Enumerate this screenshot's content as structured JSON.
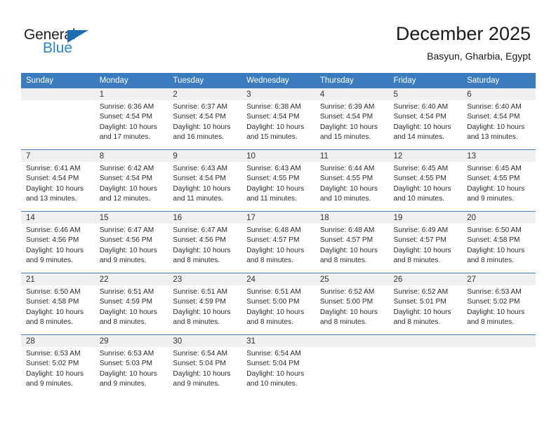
{
  "brand": {
    "name_part1": "General",
    "name_part2": "Blue",
    "triangle_color": "#1b6cb0",
    "blue_color": "#2a85d0"
  },
  "header": {
    "title": "December 2025",
    "subtitle": "Basyun, Gharbia, Egypt"
  },
  "theme": {
    "header_row_bg": "#3a7cbe",
    "daynum_band_bg": "#f0f0f0",
    "row_divider": "#4a7ebb",
    "cell_bg": "#ffffff"
  },
  "weekday_headers": [
    "Sunday",
    "Monday",
    "Tuesday",
    "Wednesday",
    "Thursday",
    "Friday",
    "Saturday"
  ],
  "weeks": [
    [
      {
        "day": "",
        "sunrise": "",
        "sunset": "",
        "daylight": ""
      },
      {
        "day": "1",
        "sunrise": "Sunrise: 6:36 AM",
        "sunset": "Sunset: 4:54 PM",
        "daylight": "Daylight: 10 hours and 17 minutes."
      },
      {
        "day": "2",
        "sunrise": "Sunrise: 6:37 AM",
        "sunset": "Sunset: 4:54 PM",
        "daylight": "Daylight: 10 hours and 16 minutes."
      },
      {
        "day": "3",
        "sunrise": "Sunrise: 6:38 AM",
        "sunset": "Sunset: 4:54 PM",
        "daylight": "Daylight: 10 hours and 15 minutes."
      },
      {
        "day": "4",
        "sunrise": "Sunrise: 6:39 AM",
        "sunset": "Sunset: 4:54 PM",
        "daylight": "Daylight: 10 hours and 15 minutes."
      },
      {
        "day": "5",
        "sunrise": "Sunrise: 6:40 AM",
        "sunset": "Sunset: 4:54 PM",
        "daylight": "Daylight: 10 hours and 14 minutes."
      },
      {
        "day": "6",
        "sunrise": "Sunrise: 6:40 AM",
        "sunset": "Sunset: 4:54 PM",
        "daylight": "Daylight: 10 hours and 13 minutes."
      }
    ],
    [
      {
        "day": "7",
        "sunrise": "Sunrise: 6:41 AM",
        "sunset": "Sunset: 4:54 PM",
        "daylight": "Daylight: 10 hours and 13 minutes."
      },
      {
        "day": "8",
        "sunrise": "Sunrise: 6:42 AM",
        "sunset": "Sunset: 4:54 PM",
        "daylight": "Daylight: 10 hours and 12 minutes."
      },
      {
        "day": "9",
        "sunrise": "Sunrise: 6:43 AM",
        "sunset": "Sunset: 4:54 PM",
        "daylight": "Daylight: 10 hours and 11 minutes."
      },
      {
        "day": "10",
        "sunrise": "Sunrise: 6:43 AM",
        "sunset": "Sunset: 4:55 PM",
        "daylight": "Daylight: 10 hours and 11 minutes."
      },
      {
        "day": "11",
        "sunrise": "Sunrise: 6:44 AM",
        "sunset": "Sunset: 4:55 PM",
        "daylight": "Daylight: 10 hours and 10 minutes."
      },
      {
        "day": "12",
        "sunrise": "Sunrise: 6:45 AM",
        "sunset": "Sunset: 4:55 PM",
        "daylight": "Daylight: 10 hours and 10 minutes."
      },
      {
        "day": "13",
        "sunrise": "Sunrise: 6:45 AM",
        "sunset": "Sunset: 4:55 PM",
        "daylight": "Daylight: 10 hours and 9 minutes."
      }
    ],
    [
      {
        "day": "14",
        "sunrise": "Sunrise: 6:46 AM",
        "sunset": "Sunset: 4:56 PM",
        "daylight": "Daylight: 10 hours and 9 minutes."
      },
      {
        "day": "15",
        "sunrise": "Sunrise: 6:47 AM",
        "sunset": "Sunset: 4:56 PM",
        "daylight": "Daylight: 10 hours and 9 minutes."
      },
      {
        "day": "16",
        "sunrise": "Sunrise: 6:47 AM",
        "sunset": "Sunset: 4:56 PM",
        "daylight": "Daylight: 10 hours and 8 minutes."
      },
      {
        "day": "17",
        "sunrise": "Sunrise: 6:48 AM",
        "sunset": "Sunset: 4:57 PM",
        "daylight": "Daylight: 10 hours and 8 minutes."
      },
      {
        "day": "18",
        "sunrise": "Sunrise: 6:48 AM",
        "sunset": "Sunset: 4:57 PM",
        "daylight": "Daylight: 10 hours and 8 minutes."
      },
      {
        "day": "19",
        "sunrise": "Sunrise: 6:49 AM",
        "sunset": "Sunset: 4:57 PM",
        "daylight": "Daylight: 10 hours and 8 minutes."
      },
      {
        "day": "20",
        "sunrise": "Sunrise: 6:50 AM",
        "sunset": "Sunset: 4:58 PM",
        "daylight": "Daylight: 10 hours and 8 minutes."
      }
    ],
    [
      {
        "day": "21",
        "sunrise": "Sunrise: 6:50 AM",
        "sunset": "Sunset: 4:58 PM",
        "daylight": "Daylight: 10 hours and 8 minutes."
      },
      {
        "day": "22",
        "sunrise": "Sunrise: 6:51 AM",
        "sunset": "Sunset: 4:59 PM",
        "daylight": "Daylight: 10 hours and 8 minutes."
      },
      {
        "day": "23",
        "sunrise": "Sunrise: 6:51 AM",
        "sunset": "Sunset: 4:59 PM",
        "daylight": "Daylight: 10 hours and 8 minutes."
      },
      {
        "day": "24",
        "sunrise": "Sunrise: 6:51 AM",
        "sunset": "Sunset: 5:00 PM",
        "daylight": "Daylight: 10 hours and 8 minutes."
      },
      {
        "day": "25",
        "sunrise": "Sunrise: 6:52 AM",
        "sunset": "Sunset: 5:00 PM",
        "daylight": "Daylight: 10 hours and 8 minutes."
      },
      {
        "day": "26",
        "sunrise": "Sunrise: 6:52 AM",
        "sunset": "Sunset: 5:01 PM",
        "daylight": "Daylight: 10 hours and 8 minutes."
      },
      {
        "day": "27",
        "sunrise": "Sunrise: 6:53 AM",
        "sunset": "Sunset: 5:02 PM",
        "daylight": "Daylight: 10 hours and 8 minutes."
      }
    ],
    [
      {
        "day": "28",
        "sunrise": "Sunrise: 6:53 AM",
        "sunset": "Sunset: 5:02 PM",
        "daylight": "Daylight: 10 hours and 9 minutes."
      },
      {
        "day": "29",
        "sunrise": "Sunrise: 6:53 AM",
        "sunset": "Sunset: 5:03 PM",
        "daylight": "Daylight: 10 hours and 9 minutes."
      },
      {
        "day": "30",
        "sunrise": "Sunrise: 6:54 AM",
        "sunset": "Sunset: 5:04 PM",
        "daylight": "Daylight: 10 hours and 9 minutes."
      },
      {
        "day": "31",
        "sunrise": "Sunrise: 6:54 AM",
        "sunset": "Sunset: 5:04 PM",
        "daylight": "Daylight: 10 hours and 10 minutes."
      },
      {
        "day": "",
        "sunrise": "",
        "sunset": "",
        "daylight": ""
      },
      {
        "day": "",
        "sunrise": "",
        "sunset": "",
        "daylight": ""
      },
      {
        "day": "",
        "sunrise": "",
        "sunset": "",
        "daylight": ""
      }
    ]
  ]
}
